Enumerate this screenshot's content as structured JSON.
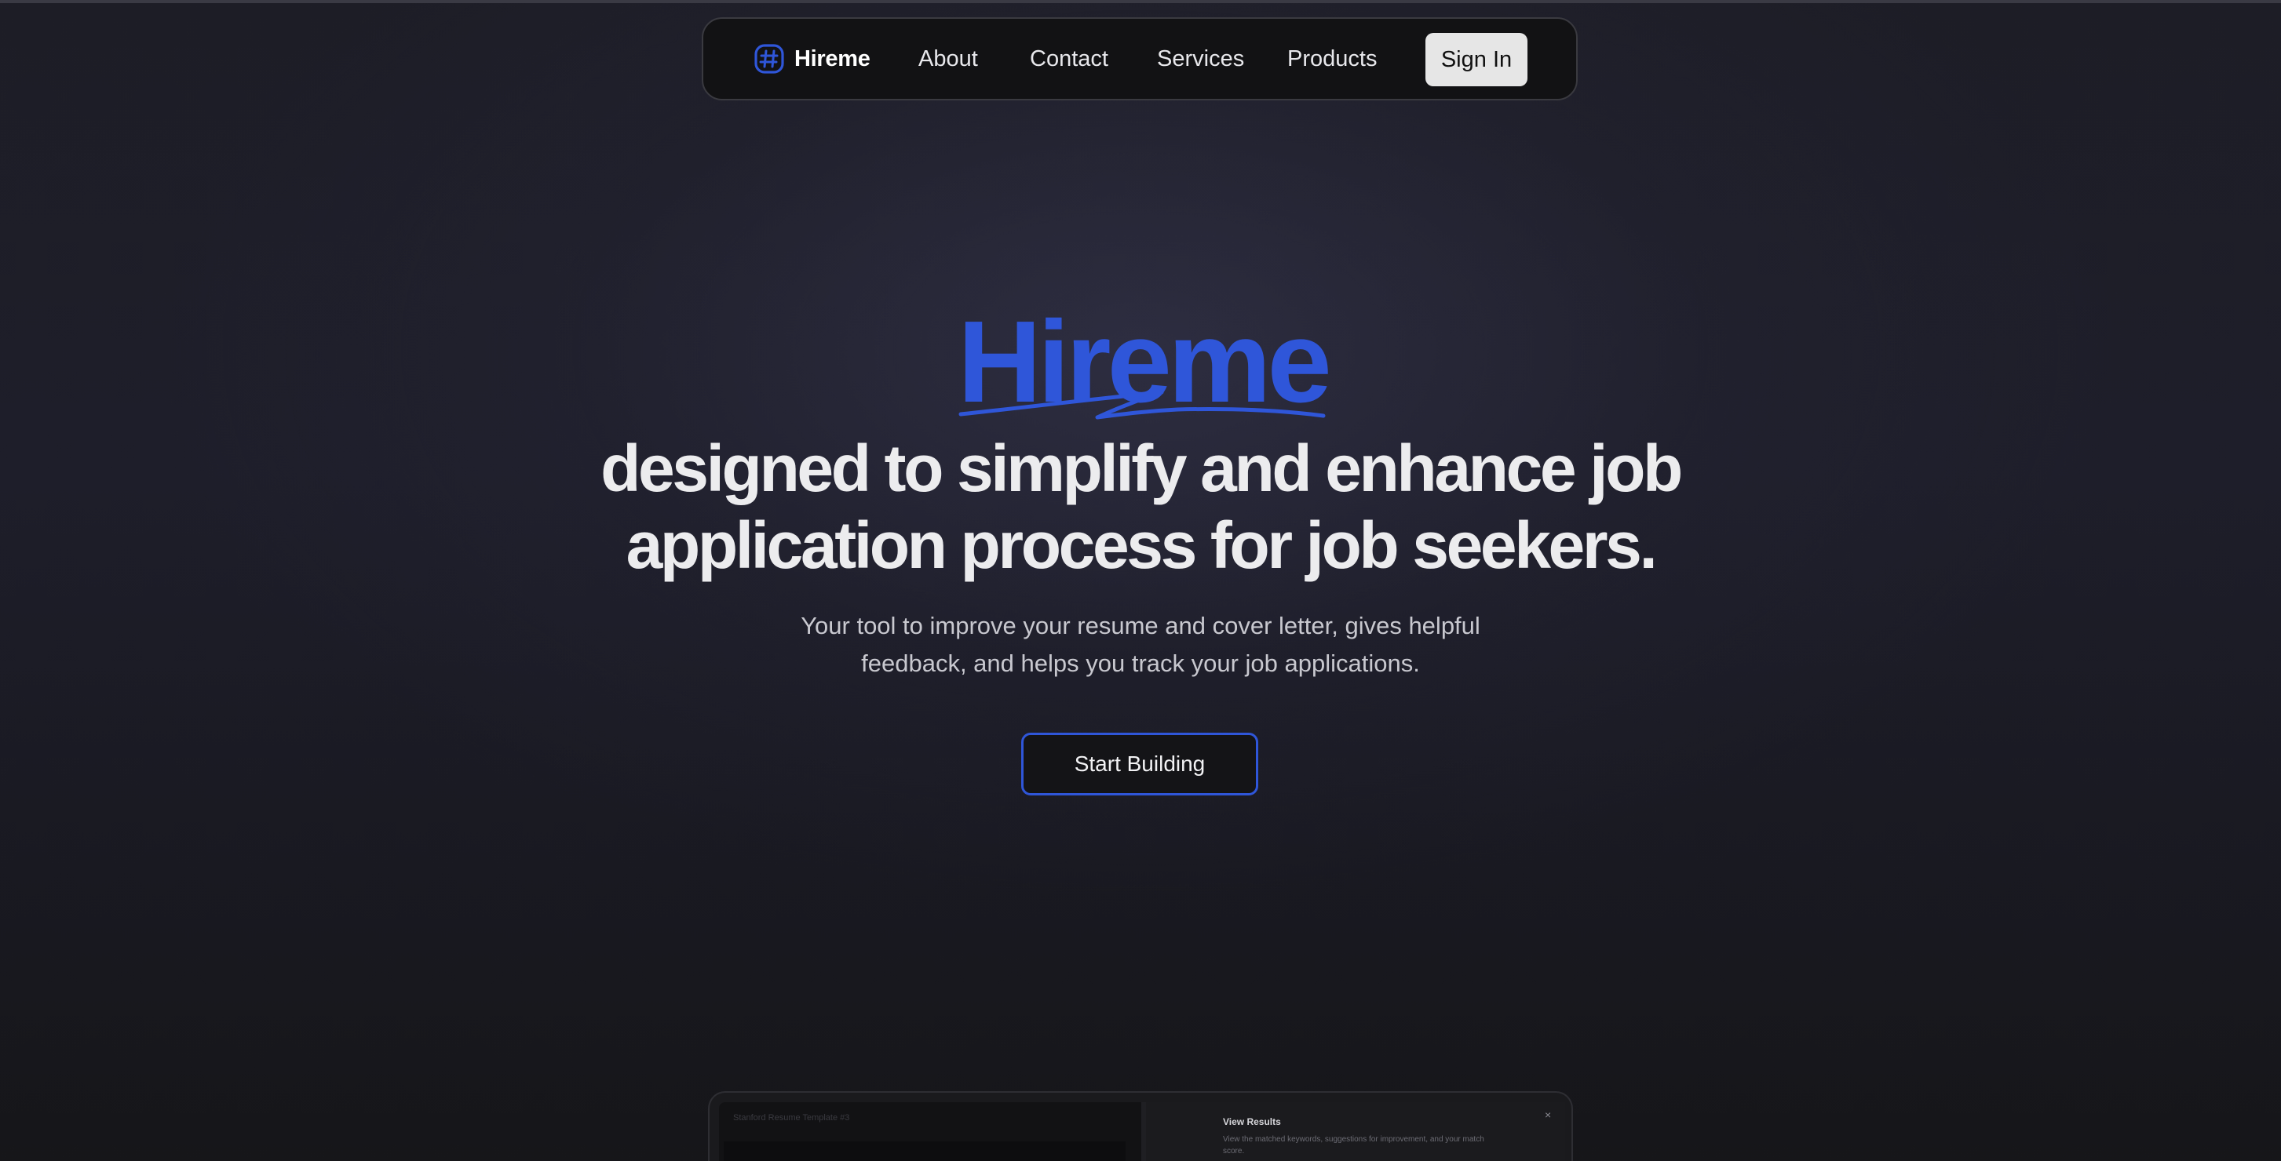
{
  "nav": {
    "brand": "Hireme",
    "links": [
      "About",
      "Contact",
      "Services",
      "Products"
    ],
    "signin_label": "Sign In"
  },
  "hero": {
    "brand_text": "Hireme",
    "headline": "designed to simplify and enhance job application process for job seekers.",
    "subtext": "Your tool to improve your resume and cover letter, gives helpful feedback, and helps you track your job applications.",
    "cta_label": "Start Building"
  },
  "preview": {
    "template_title": "Stanford Resume Template #3",
    "results_title": "View Results",
    "results_desc": "View the matched keywords, suggestions for improvement, and your match score.",
    "close_glyph": "×"
  },
  "colors": {
    "accent": "#2f56d9",
    "background": "#1d1d26",
    "nav_bg": "#121214",
    "signin_bg": "#e6e6e6"
  },
  "icons": {
    "brand": "hash-icon"
  }
}
